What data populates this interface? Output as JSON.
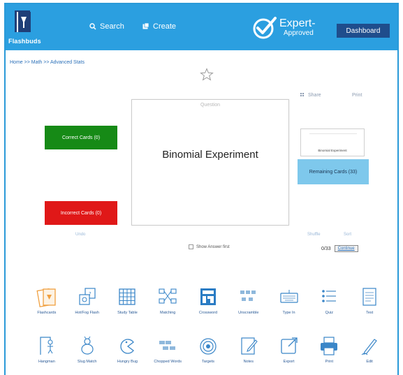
{
  "header": {
    "logo_text": "Flashbuds",
    "search_label": "Search",
    "create_label": "Create",
    "expert_line1": "Expert-",
    "expert_line2": "Approved",
    "dashboard_label": "Dashboard",
    "colors": {
      "header_bg": "#2b9fe0",
      "dashboard_bg": "#1f4d8c"
    }
  },
  "breadcrumb": "Home >> Math >> Advanced Stats",
  "toolbar": {
    "share_label": "Share",
    "print_label": "Print"
  },
  "card": {
    "side_label": "Question",
    "term": "Binomial Experiment"
  },
  "buttons": {
    "correct": "Correct Cards (0)",
    "incorrect": "Incorrect Cards (0)",
    "remaining": "Remaining Cards (33)",
    "undo": "Undo",
    "shuffle": "Shuffle",
    "sort": "Sort",
    "continue": "Continue",
    "colors": {
      "correct": "#168a16",
      "incorrect": "#e01818",
      "remaining": "#7ec8ec"
    }
  },
  "deck_preview": {
    "label": "Binomial Experiment"
  },
  "show_first_label": "Show Answer first",
  "counter": "0/33",
  "modes_row1": [
    {
      "label": "Flashcards",
      "icon": "flashcards-icon"
    },
    {
      "label": "Hot/Fog Flash",
      "icon": "hot-flash-icon"
    },
    {
      "label": "Study Table",
      "icon": "study-table-icon"
    },
    {
      "label": "Matching",
      "icon": "matching-icon"
    },
    {
      "label": "Crossword",
      "icon": "crossword-icon"
    },
    {
      "label": "Unscramble",
      "icon": "unscramble-icon"
    },
    {
      "label": "Type In",
      "icon": "type-in-icon"
    },
    {
      "label": "Quiz",
      "icon": "quiz-icon"
    },
    {
      "label": "Test",
      "icon": "test-icon"
    }
  ],
  "modes_row2": [
    {
      "label": "Hangman",
      "icon": "hangman-icon"
    },
    {
      "label": "Slug Match",
      "icon": "slug-match-icon"
    },
    {
      "label": "Hungry Bug",
      "icon": "hungry-bug-icon"
    },
    {
      "label": "Chopped Words",
      "icon": "chopped-words-icon"
    },
    {
      "label": "Targets",
      "icon": "targets-icon"
    },
    {
      "label": "Notes",
      "icon": "notes-icon"
    },
    {
      "label": "Export",
      "icon": "export-icon"
    },
    {
      "label": "Print",
      "icon": "print-icon"
    },
    {
      "label": "Edit",
      "icon": "edit-icon"
    }
  ]
}
